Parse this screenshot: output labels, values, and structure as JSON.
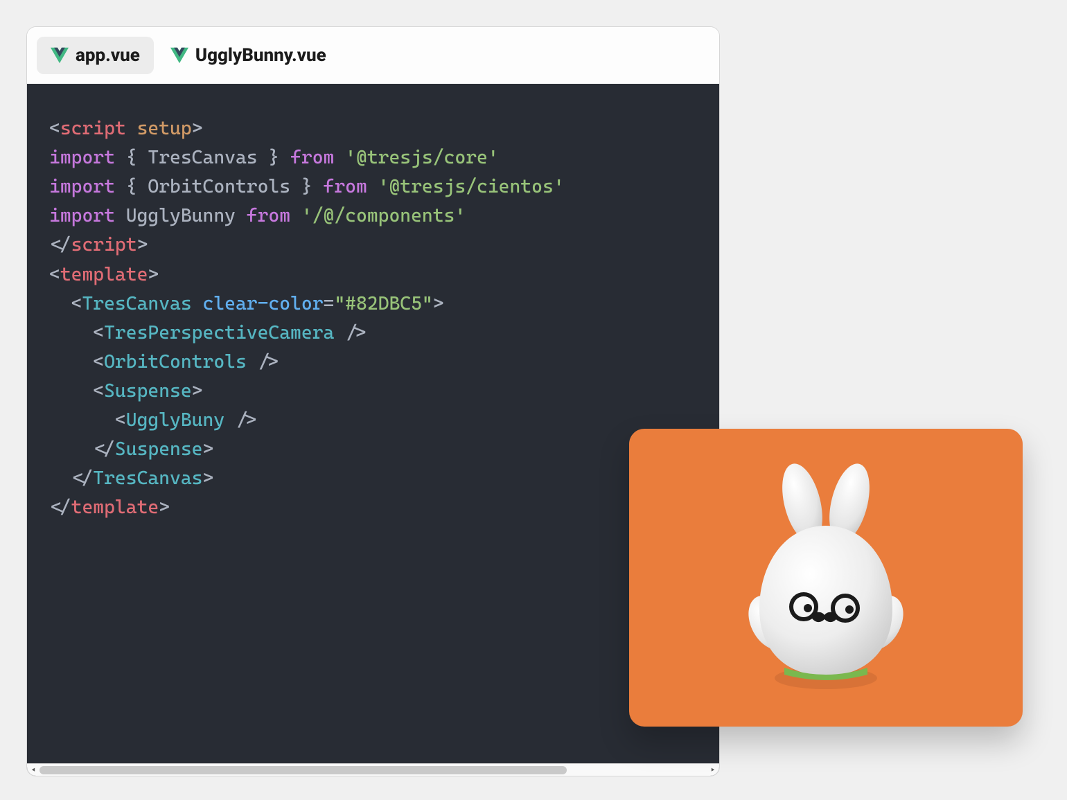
{
  "tabs": [
    {
      "label": "app.vue",
      "active": true
    },
    {
      "label": "UgglyBunny.vue",
      "active": false
    }
  ],
  "code": {
    "line1": {
      "lt": "<",
      "tag": "script",
      "sp": " ",
      "attr": "setup",
      "gt": ">"
    },
    "line2": {
      "kw": "import",
      "sp": " ",
      "lb": "{ ",
      "id": "TresCanvas",
      "rb": " }",
      "sp2": " ",
      "from": "from",
      "sp3": " ",
      "str": "'@tresjs/core'"
    },
    "line3": {
      "kw": "import",
      "sp": " ",
      "lb": "{ ",
      "id": "OrbitControls",
      "rb": " }",
      "sp2": " ",
      "from": "from",
      "sp3": " ",
      "str": "'@tresjs/cientos'"
    },
    "line4": {
      "kw": "import",
      "sp": " ",
      "id": "UgglyBunny",
      "sp2": " ",
      "from": "from",
      "sp3": " ",
      "str": "'/@/components'"
    },
    "line5": {
      "lt": "</",
      "tag": "script",
      "gt": ">"
    },
    "line6": {
      "lt": "<",
      "tag": "template",
      "gt": ">"
    },
    "line7": {
      "ind": "  ",
      "lt": "<",
      "comp": "TresCanvas",
      "sp": " ",
      "attr": "clear-color",
      "eq": "=",
      "str": "\"#82DBC5\"",
      "gt": ">"
    },
    "line8": {
      "ind": "    ",
      "lt": "<",
      "comp": "TresPerspectiveCamera",
      "sp": " ",
      "gt": "/>"
    },
    "line9": {
      "ind": "    ",
      "lt": "<",
      "comp": "OrbitControls",
      "sp": " ",
      "gt": "/>"
    },
    "line10": {
      "ind": "    ",
      "lt": "<",
      "comp": "Suspense",
      "gt": ">"
    },
    "line11": {
      "ind": "      ",
      "lt": "<",
      "comp": "UgglyBuny",
      "sp": " ",
      "gt": "/>"
    },
    "line12": {
      "ind": "    ",
      "lt": "</",
      "comp": "Suspense",
      "gt": ">"
    },
    "line13": {
      "ind": "  ",
      "lt": "</",
      "comp": "TresCanvas",
      "gt": ">"
    },
    "line14": {
      "lt": "</",
      "tag": "template",
      "gt": ">"
    }
  },
  "preview": {
    "bg_color": "#ea7d3c",
    "model_name": "UgglyBunny"
  },
  "icons": {
    "vue": "vue-icon"
  }
}
